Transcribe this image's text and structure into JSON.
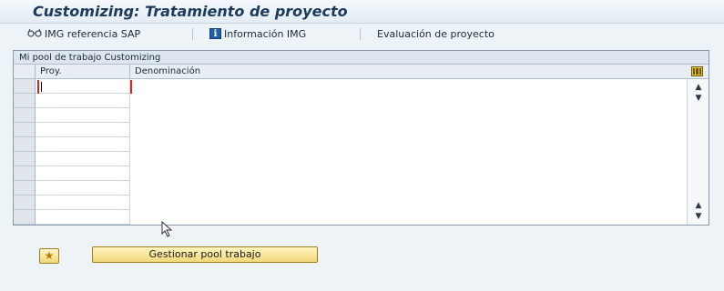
{
  "window": {
    "title": "Customizing: Tratamiento de proyecto"
  },
  "toolbar": {
    "img_ref_label": "IMG referencia SAP",
    "img_ref_icon": "glasses-icon",
    "info_img_label": "Información IMG",
    "info_img_icon": "info-icon",
    "info_icon_glyph": "i",
    "evaluacion_label": "Evaluación de proyecto"
  },
  "grid": {
    "caption": "Mi pool de trabajo Customizing",
    "columns": [
      "Proy.",
      "Denominación"
    ],
    "rows": [
      [
        "",
        ""
      ],
      [
        "",
        ""
      ],
      [
        "",
        ""
      ],
      [
        "",
        ""
      ],
      [
        "",
        ""
      ],
      [
        "",
        ""
      ],
      [
        "",
        ""
      ],
      [
        "",
        ""
      ],
      [
        "",
        ""
      ],
      [
        "",
        ""
      ]
    ],
    "config_icon": "column-config-icon"
  },
  "actions": {
    "favorites_icon": "star-favorites-icon",
    "manage_pool_label": "Gestionar pool trabajo"
  },
  "colors": {
    "title_text": "#1c3a5c",
    "button_bg": "#f2d87a",
    "focus_border": "#dd2222",
    "background": "#eef3f8"
  }
}
